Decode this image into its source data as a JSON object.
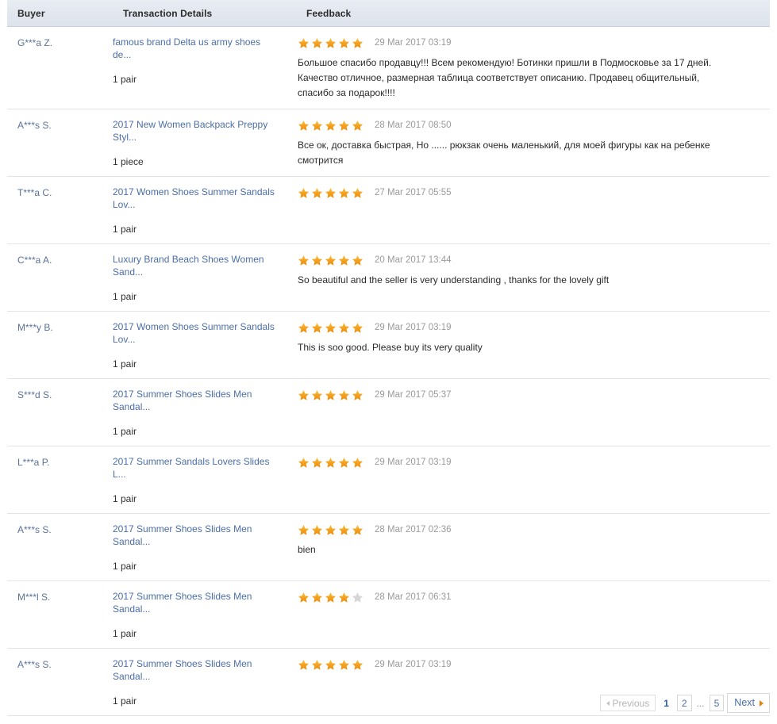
{
  "table": {
    "columns": {
      "buyer": "Buyer",
      "details": "Transaction Details",
      "feedback": "Feedback"
    },
    "rows": [
      {
        "buyer": "G***a Z.",
        "product": "famous brand Delta us army shoes de...",
        "quantity": "1 pair",
        "rating": 5,
        "date": "29 Mar 2017 03:19",
        "comment": "Большое спасибо продавцу!!! Всем рекомендую! Ботинки пришли в Подмосковье за 17 дней. Качество отличное, размерная таблица соответствует описанию. Продавец общительный, спасибо за подарок!!!!"
      },
      {
        "buyer": "A***s S.",
        "product": "2017 New Women Backpack Preppy Styl...",
        "quantity": "1 piece",
        "rating": 5,
        "date": "28 Mar 2017 08:50",
        "comment": "Все ок, доставка быстрая, Но ...... рюкзак очень маленький, для моей фигуры как на ребенке смотрится"
      },
      {
        "buyer": "T***a C.",
        "product": "2017 Women Shoes Summer Sandals Lov...",
        "quantity": "1 pair",
        "rating": 5,
        "date": "27 Mar 2017 05:55",
        "comment": ""
      },
      {
        "buyer": "C***a A.",
        "product": "Luxury Brand Beach Shoes Women Sand...",
        "quantity": "1 pair",
        "rating": 5,
        "date": "20 Mar 2017 13:44",
        "comment": "So beautiful and the seller is very understanding , thanks for the lovely gift"
      },
      {
        "buyer": "M***y B.",
        "product": "2017 Women Shoes Summer Sandals Lov...",
        "quantity": "1 pair",
        "rating": 5,
        "date": "29 Mar 2017 03:19",
        "comment": "This is soo good. Please buy its very quality"
      },
      {
        "buyer": "S***d S.",
        "product": "2017 Summer Shoes Slides Men Sandal...",
        "quantity": "1 pair",
        "rating": 5,
        "date": "29 Mar 2017 05:37",
        "comment": ""
      },
      {
        "buyer": "L***a P.",
        "product": "2017 Summer Sandals Lovers Slides L...",
        "quantity": "1 pair",
        "rating": 5,
        "date": "29 Mar 2017 03:19",
        "comment": ""
      },
      {
        "buyer": "A***s S.",
        "product": "2017 Summer Shoes Slides Men Sandal...",
        "quantity": "1 pair",
        "rating": 5,
        "date": "28 Mar 2017 02:36",
        "comment": "bien"
      },
      {
        "buyer": "M***l S.",
        "product": "2017 Summer Shoes Slides Men Sandal...",
        "quantity": "1 pair",
        "rating": 4,
        "date": "28 Mar 2017 06:31",
        "comment": ""
      },
      {
        "buyer": "A***s S.",
        "product": "2017 Summer Shoes Slides Men Sandal...",
        "quantity": "1 pair",
        "rating": 5,
        "date": "29 Mar 2017 03:19",
        "comment": ""
      }
    ]
  },
  "pagination": {
    "previous_label": "Previous",
    "next_label": "Next",
    "pages": [
      "1",
      "2",
      "...",
      "5"
    ],
    "current_page": "1",
    "previous_disabled": true
  },
  "colors": {
    "star_filled": "#f5a623",
    "star_empty": "#d6d6d6",
    "link": "#4b6ea9",
    "buyer": "#5b7397",
    "date": "#9a9a9a",
    "header_bg": "#e4e9f1",
    "next_arrow": "#e8820c"
  },
  "icons": {
    "star_filled": "star-filled-icon",
    "star_empty": "star-empty-icon",
    "prev_arrow": "triangle-left-icon",
    "next_arrow": "triangle-right-icon"
  }
}
